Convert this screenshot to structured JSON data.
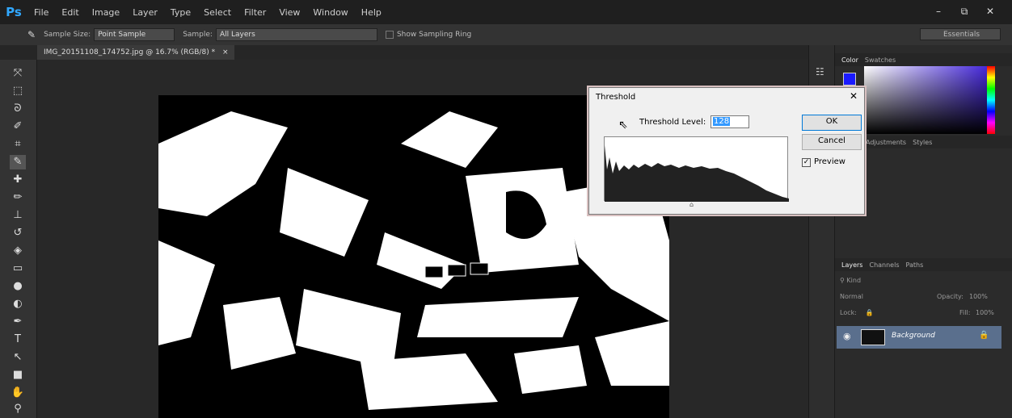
{
  "app": {
    "logo": "Ps"
  },
  "menu": [
    "File",
    "Edit",
    "Image",
    "Layer",
    "Type",
    "Select",
    "Filter",
    "View",
    "Window",
    "Help"
  ],
  "window_controls": {
    "minimize": "–",
    "restore": "⧉",
    "close": "✕"
  },
  "options_bar": {
    "sample_size_label": "Sample Size:",
    "sample_size_value": "Point Sample",
    "sample_label": "Sample:",
    "sample_value": "All Layers",
    "show_ring_label": "Show Sampling Ring",
    "workspace": "Essentials"
  },
  "document_tab": {
    "title": "IMG_20151108_174752.jpg @ 16.7% (RGB/8) *",
    "close": "×"
  },
  "panels": {
    "color_tabs": [
      "Color",
      "Swatches"
    ],
    "adjust_tabs": [
      "Adjustments",
      "Styles"
    ],
    "layers_tabs": [
      "Layers",
      "Channels",
      "Paths"
    ],
    "kind_label": "Kind",
    "blend_mode": "Normal",
    "opacity_label": "Opacity:",
    "opacity_value": "100%",
    "lock_label": "Lock:",
    "fill_label": "Fill:",
    "fill_value": "100%",
    "layer_name": "Background",
    "foreground_color": "#1a1aff"
  },
  "dialog": {
    "title": "Threshold",
    "close": "✕",
    "threshold_label": "Threshold Level:",
    "threshold_value": "128",
    "ok": "OK",
    "cancel": "Cancel",
    "preview_label": "Preview",
    "preview_checked": true
  }
}
